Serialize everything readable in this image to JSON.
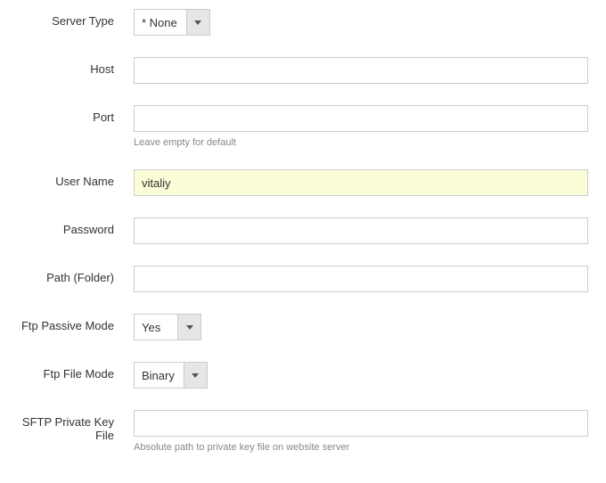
{
  "labels": {
    "server_type": "Server Type",
    "host": "Host",
    "port": "Port",
    "user_name": "User Name",
    "password": "Password",
    "path": "Path (Folder)",
    "ftp_passive_mode": "Ftp Passive Mode",
    "ftp_file_mode": "Ftp File Mode",
    "sftp_private_key": "SFTP Private Key File"
  },
  "values": {
    "server_type": "* None",
    "host": "",
    "port": "",
    "user_name": "vitaliy",
    "password": "",
    "path": "",
    "ftp_passive_mode": "Yes",
    "ftp_file_mode": "Binary",
    "sftp_private_key": ""
  },
  "help": {
    "port": "Leave empty for default",
    "sftp_private_key": "Absolute path to private key file on website server"
  }
}
